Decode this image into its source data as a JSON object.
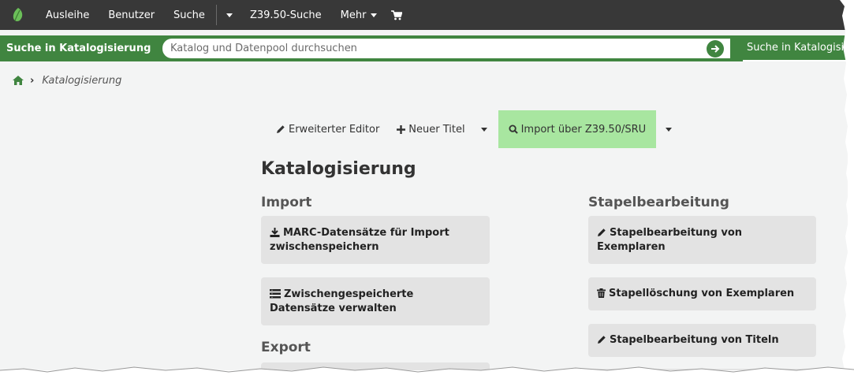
{
  "navbar": {
    "items": [
      {
        "label": "Ausleihe"
      },
      {
        "label": "Benutzer"
      },
      {
        "label": "Suche"
      },
      {
        "label": "Z39.50-Suche"
      },
      {
        "label": "Mehr"
      }
    ]
  },
  "searchbar": {
    "label": "Suche in Katalogisierung",
    "placeholder": "Katalog und Datenpool durchsuchen",
    "link": "Suche in Katalogisierung"
  },
  "breadcrumb": {
    "current": "Katalogisierung"
  },
  "toolbar": {
    "advanced_editor": "Erweiterter Editor",
    "new_record": "Neuer Titel",
    "z3950": "Import über Z39.50/SRU"
  },
  "main": {
    "title": "Katalogisierung",
    "import_heading": "Import",
    "export_heading": "Export",
    "batch_heading": "Stapelbearbeitung",
    "import_tiles": [
      {
        "label": "MARC-Datensätze für Import zwischenspeichern"
      },
      {
        "label": "Zwischengespeicherte Datensätze verwalten"
      }
    ],
    "batch_tiles": [
      {
        "label": "Stapelbearbeitung von Exemplaren"
      },
      {
        "label": "Stapellöschung von Exemplaren"
      },
      {
        "label": "Stapelbearbeitung von Titeln"
      }
    ]
  },
  "colors": {
    "navbar": "#383838",
    "search_bar": "#408540",
    "active_tool": "#a8e6a0",
    "tile": "#e3e3e3",
    "page_bg": "#f3f4f4"
  }
}
